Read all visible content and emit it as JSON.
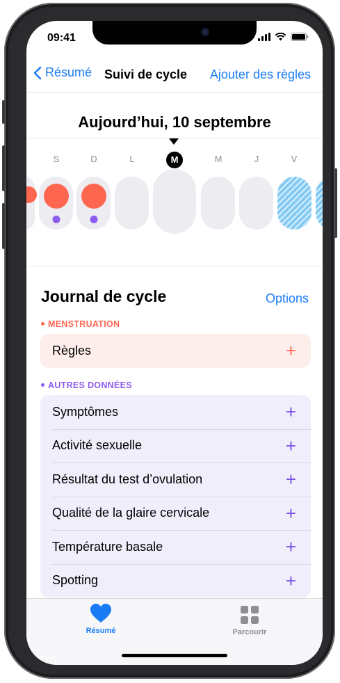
{
  "status_bar": {
    "time": "09:41"
  },
  "nav": {
    "back_label": "Résumé",
    "title": "Suivi de cycle",
    "action_label": "Ajouter des règles"
  },
  "calendar": {
    "date_heading": "Aujourd’hui, 10 septembre",
    "days": [
      {
        "label": "S"
      },
      {
        "label": "D"
      },
      {
        "label": "L"
      },
      {
        "label": "M",
        "today": true
      },
      {
        "label": "M"
      },
      {
        "label": "J"
      },
      {
        "label": "V"
      }
    ]
  },
  "journal": {
    "title": "Journal de cycle",
    "options_label": "Options",
    "menstruation": {
      "label": "MENSTRUATION",
      "color": "#ff6650",
      "items": [
        "Règles"
      ]
    },
    "other": {
      "label": "AUTRES DONNÉES",
      "color": "#8d5cf0",
      "items": [
        "Symptômes",
        "Activité sexuelle",
        "Résultat du test d’ovulation",
        "Qualité de la glaire cervicale",
        "Température basale",
        "Spotting"
      ]
    }
  },
  "tabbar": {
    "tabs": [
      {
        "label": "Résumé",
        "icon": "heart-icon",
        "active": true
      },
      {
        "label": "Parcourir",
        "icon": "grid-icon",
        "active": false
      }
    ]
  },
  "colors": {
    "accent": "#1a7cf5",
    "flow": "#ff6650",
    "other": "#8d5cf0",
    "predicted": "#7ec7f2"
  }
}
